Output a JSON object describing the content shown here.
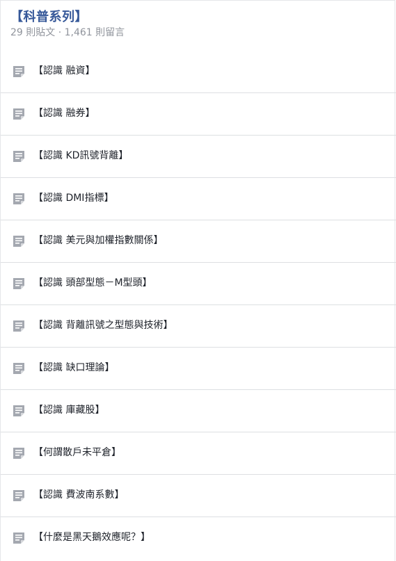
{
  "header": {
    "title": "【科普系列】",
    "meta": "29 則貼文 · 1,461 則留言"
  },
  "icon_name": "note-icon",
  "colors": {
    "title": "#365899",
    "meta": "#90949c",
    "icon": "#a4a8b0"
  },
  "items": [
    {
      "label": "【認識 融資】"
    },
    {
      "label": "【認識 融券】"
    },
    {
      "label": "【認識 KD訊號背離】"
    },
    {
      "label": "【認識 DMI指標】"
    },
    {
      "label": "【認識 美元與加權指數關係】"
    },
    {
      "label": "【認識 頭部型態－M型頭】"
    },
    {
      "label": "【認識 背離訊號之型態與技術】"
    },
    {
      "label": "【認識 缺口理論】"
    },
    {
      "label": "【認識 庫藏股】"
    },
    {
      "label": "【何謂散戶未平倉】"
    },
    {
      "label": "【認識 費波南系數】"
    },
    {
      "label": "【什麼是黑天鵝效應呢？】"
    }
  ]
}
